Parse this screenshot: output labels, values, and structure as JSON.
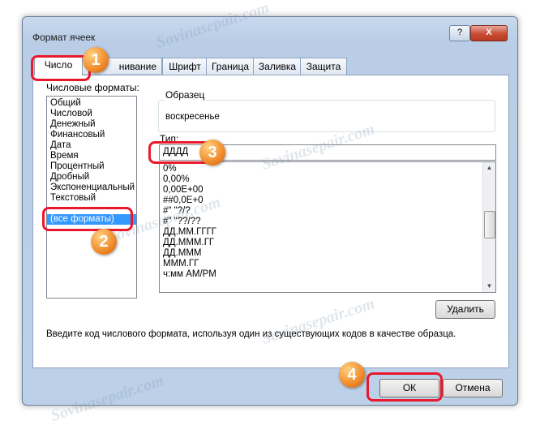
{
  "dialog": {
    "title": "Формат ячеек",
    "help_label": "?",
    "close_label": "X"
  },
  "tabs": [
    {
      "label": "Число",
      "active": true
    },
    {
      "label": "нивание",
      "active": false
    },
    {
      "label": "Шрифт",
      "active": false
    },
    {
      "label": "Граница",
      "active": false
    },
    {
      "label": "Заливка",
      "active": false
    },
    {
      "label": "Защита",
      "active": false
    }
  ],
  "categories": {
    "label": "Числовые форматы:",
    "items": [
      "Общий",
      "Числовой",
      "Денежный",
      "Финансовый",
      "Дата",
      "Время",
      "Процентный",
      "Дробный",
      "Экспоненциальный",
      "Текстовый",
      "(все форматы)"
    ],
    "selected": "(все форматы)"
  },
  "sample": {
    "label": "Образец",
    "value": "воскресенье"
  },
  "type": {
    "label": "Тип:",
    "value": "ДДДД",
    "list": [
      "0%",
      "0,00%",
      "0,00E+00",
      "##0,0E+0",
      "#\" \"?/?",
      "#\" \"??/??",
      "ДД.ММ.ГГГГ",
      "ДД.МММ.ГГ",
      "ДД.МММ",
      "МММ.ГГ",
      "ч:мм AM/PM"
    ]
  },
  "buttons": {
    "delete": "Удалить",
    "ok": "ОК",
    "cancel": "Отмена"
  },
  "hint": "Введите код числового формата, используя один из существующих кодов в качестве образца.",
  "markers": [
    "1",
    "2",
    "3",
    "4"
  ],
  "watermark": "Sovinasepair.com",
  "colors": {
    "highlight": "#e8192c",
    "marker": "#f08a2a",
    "selection": "#3399ff"
  }
}
